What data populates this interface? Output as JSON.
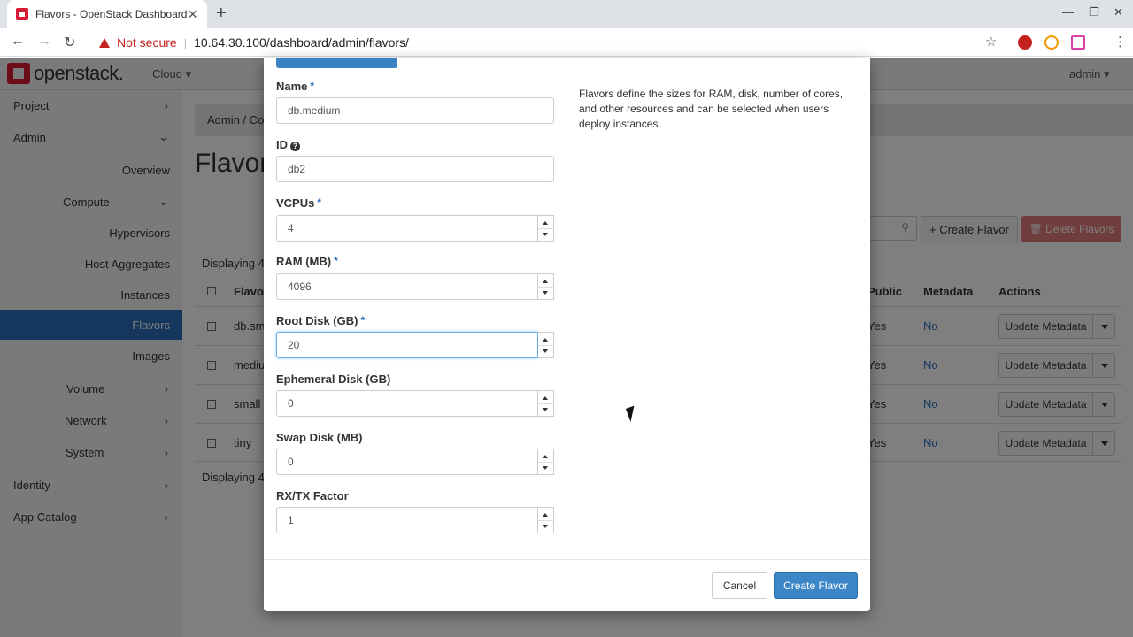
{
  "browser": {
    "tab_title": "Flavors - OpenStack Dashboard",
    "tab_close": "✕",
    "new_tab": "+",
    "security_label": "Not secure",
    "url": "10.64.30.100/dashboard/admin/flavors/"
  },
  "topnav": {
    "logo_text": "openstack.",
    "project_dropdown": "Cloud ▾",
    "user_dropdown": "admin ▾"
  },
  "sidebar": {
    "project": "Project",
    "admin": "Admin",
    "overview": "Overview",
    "compute": "Compute",
    "hypervisors": "Hypervisors",
    "host_aggregates": "Host Aggregates",
    "instances": "Instances",
    "flavors": "Flavors",
    "images": "Images",
    "volume": "Volume",
    "network": "Network",
    "system": "System",
    "identity": "Identity",
    "app_catalog": "App Catalog"
  },
  "page": {
    "breadcrumb": "Admin /  Co",
    "title": "Flavors",
    "create_flavor_btn": "+ Create Flavor",
    "delete_flavors_btn": "🗑 Delete Flavors",
    "displaying_top": "Displaying 4",
    "displaying_bottom": "Displaying 4",
    "columns": {
      "flavor": "Flavo",
      "public": "Public",
      "metadata": "Metadata",
      "actions": "Actions"
    },
    "rows": [
      {
        "name": "db.sm",
        "public": "Yes",
        "metadata": "No",
        "action": "Update Metadata"
      },
      {
        "name": "mediu",
        "public": "Yes",
        "metadata": "No",
        "action": "Update Metadata"
      },
      {
        "name": "small",
        "public": "Yes",
        "metadata": "No",
        "action": "Update Metadata"
      },
      {
        "name": "tiny",
        "public": "Yes",
        "metadata": "No",
        "action": "Update Metadata"
      }
    ]
  },
  "modal": {
    "description": "Flavors define the sizes for RAM, disk, number of cores, and other resources and can be selected when users deploy instances.",
    "required_mark": "*",
    "fields": {
      "name": {
        "label": "Name",
        "value": "db.medium"
      },
      "id": {
        "label": "ID",
        "value": "db2"
      },
      "vcpus": {
        "label": "VCPUs",
        "value": "4"
      },
      "ram": {
        "label": "RAM (MB)",
        "value": "4096"
      },
      "root_disk": {
        "label": "Root Disk (GB)",
        "value": "20"
      },
      "ephemeral_disk": {
        "label": "Ephemeral Disk (GB)",
        "value": "0"
      },
      "swap_disk": {
        "label": "Swap Disk (MB)",
        "value": "0"
      },
      "rxtx": {
        "label": "RX/TX Factor",
        "value": "1"
      }
    },
    "cancel_btn": "Cancel",
    "submit_btn": "Create Flavor"
  },
  "icons": {
    "help": "?",
    "star": "☆",
    "menu": "⋮",
    "back": "←",
    "forward": "→",
    "reload": "↻",
    "chevron_right": "›",
    "chevron_down": "⌄"
  },
  "colors": {
    "brand_red": "#da1a32",
    "primary_blue": "#3c86c8",
    "active_nav": "#2a6ebb",
    "danger_light": "#e07a7a"
  }
}
